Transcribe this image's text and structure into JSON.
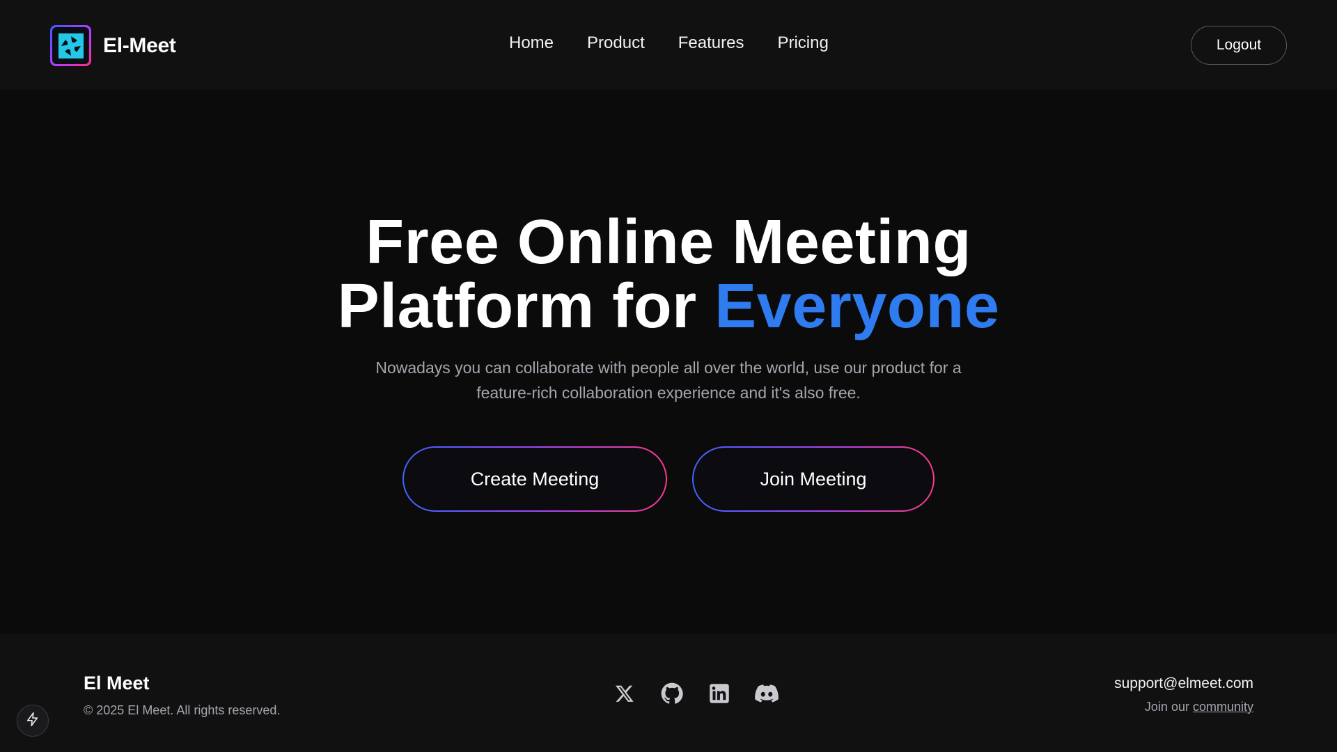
{
  "header": {
    "brand_name": "El-Meet",
    "logo_icon": "aperture-icon",
    "nav": [
      {
        "label": "Home"
      },
      {
        "label": "Product"
      },
      {
        "label": "Features"
      },
      {
        "label": "Pricing"
      }
    ],
    "logout_label": "Logout"
  },
  "hero": {
    "title_line1": "Free Online Meeting",
    "title_line2_prefix": "Platform for ",
    "title_accent": "Everyone",
    "subtitle": "Nowadays you can collaborate with people all over the world, use our product for a feature-rich collaboration experience and it's also free.",
    "create_label": "Create Meeting",
    "join_label": "Join Meeting"
  },
  "footer": {
    "brand": "El Meet",
    "copyright": "© 2025 El Meet. All rights reserved.",
    "socials": [
      "x-icon",
      "github-icon",
      "linkedin-icon",
      "discord-icon"
    ],
    "email": "support@elmeet.com",
    "community_prefix": "Join our ",
    "community_link": "community"
  },
  "colors": {
    "background": "#0b0b0c",
    "header_bg": "#111112",
    "accent_blue": "#2f7bf0",
    "gradient_start": "#3f63ff",
    "gradient_end": "#ff3a8a",
    "muted_text": "#a4a6ad"
  }
}
